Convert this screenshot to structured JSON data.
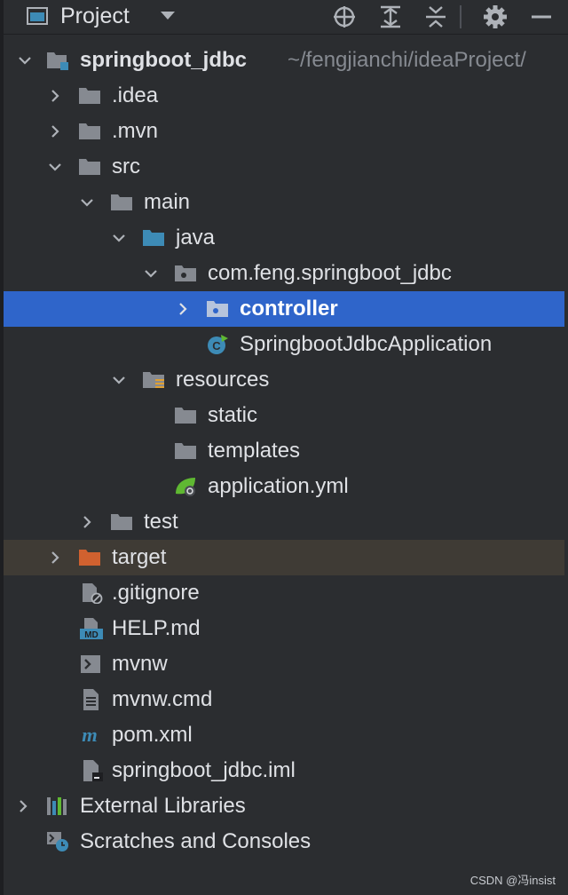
{
  "toolbar": {
    "title": "Project",
    "icons": [
      "project-panel-icon",
      "dropdown-icon",
      "locate-icon",
      "expand-all-icon",
      "collapse-all-icon",
      "gear-icon",
      "hide-icon"
    ]
  },
  "tree": {
    "root": {
      "label": "springboot_jdbc",
      "path": "~/fengjianchi/ideaProject/"
    },
    "idea": ".idea",
    "mvn": ".mvn",
    "src": "src",
    "main": "main",
    "java": "java",
    "package": "com.feng.springboot_jdbc",
    "controller": "controller",
    "application_class": "SpringbootJdbcApplication",
    "resources": "resources",
    "static": "static",
    "templates": "templates",
    "application_yml": "application.yml",
    "test": "test",
    "target": "target",
    "gitignore": ".gitignore",
    "help": "HELP.md",
    "mvnw": "mvnw",
    "mvnw_cmd": "mvnw.cmd",
    "pom": "pom.xml",
    "iml": "springboot_jdbc.iml",
    "external_libraries": "External Libraries",
    "scratches": "Scratches and Consoles"
  },
  "colors": {
    "background": "#2b2d30",
    "selection": "#2f65ca",
    "excluded_row": "#3f3b35",
    "folder": "#868a91",
    "source_folder": "#3d8bb6",
    "excluded_folder": "#d0612f",
    "java_class": "#3d8bb6",
    "maven": "#3d8bb6"
  },
  "watermark": "CSDN @冯insist"
}
